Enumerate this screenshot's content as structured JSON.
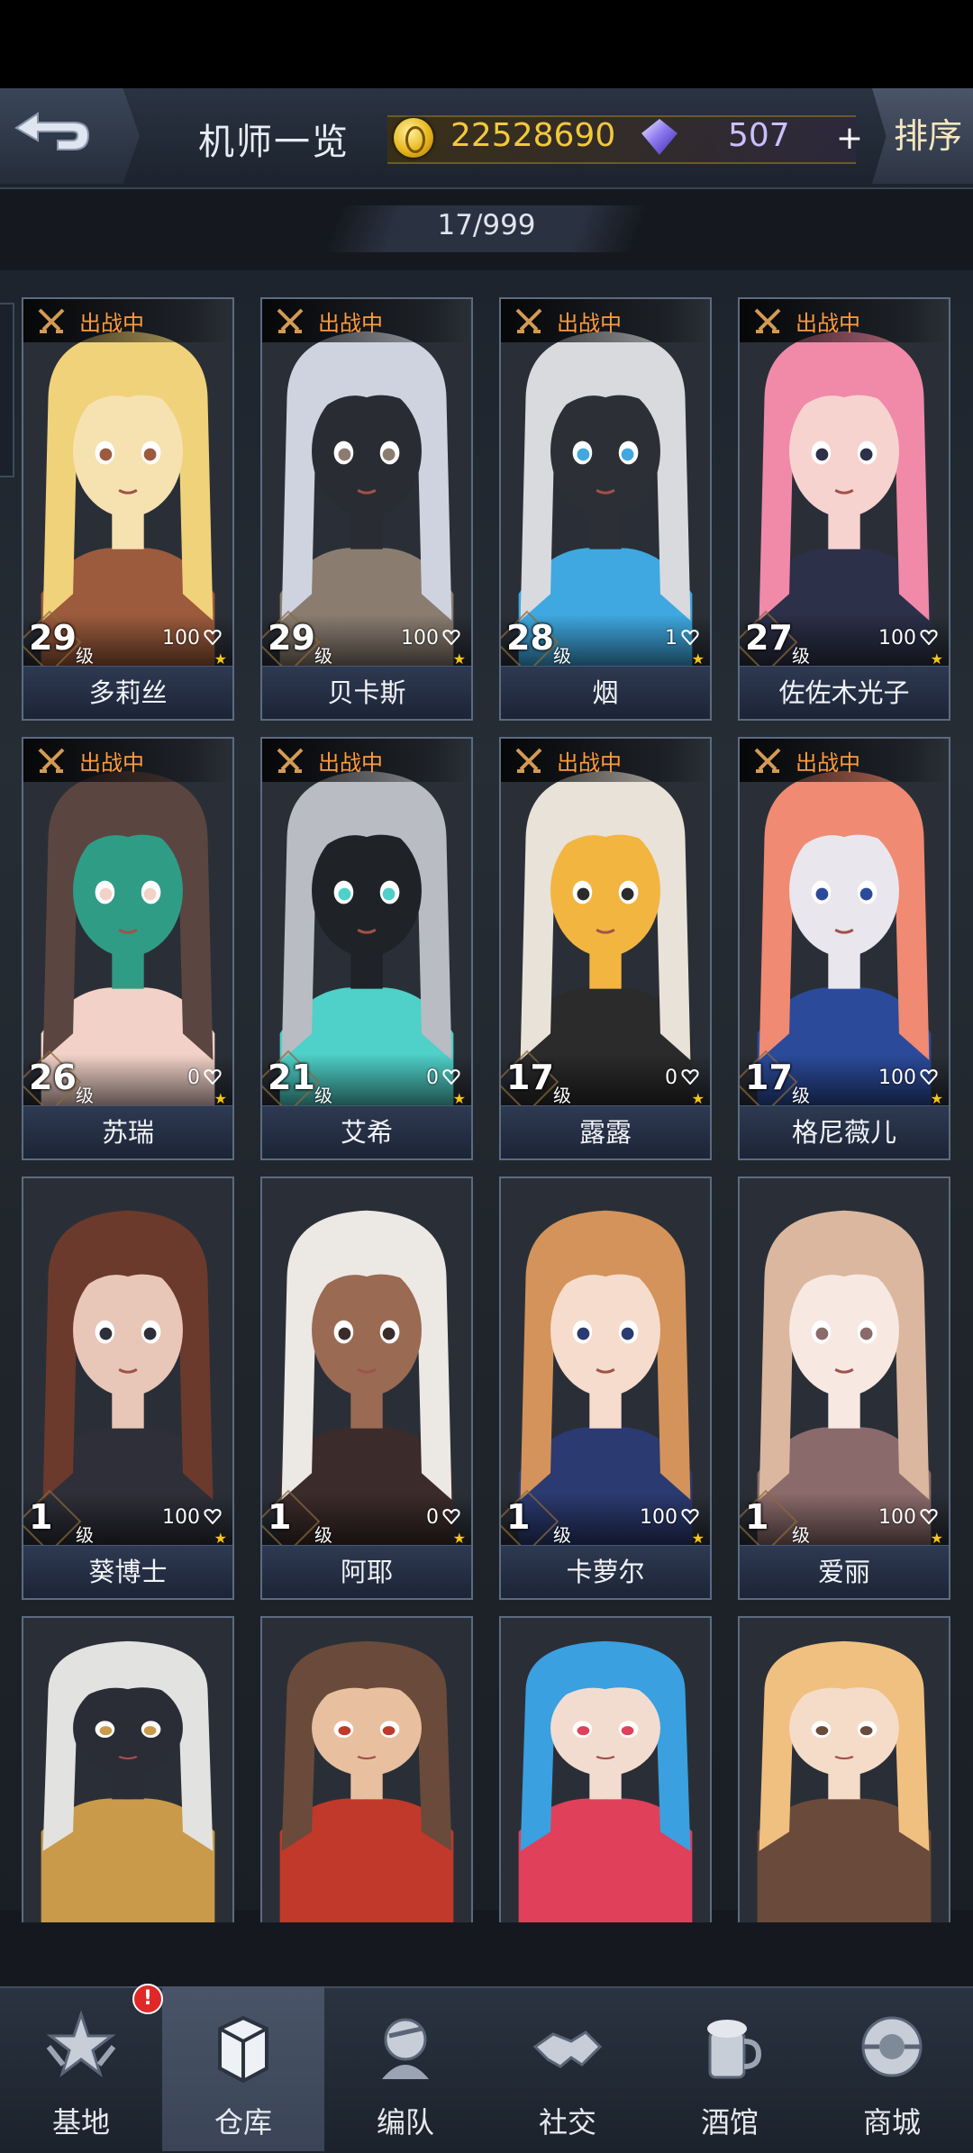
{
  "header": {
    "title": "机师一览",
    "gold": "22528690",
    "gems": "507",
    "plus": "+",
    "sort": "排序"
  },
  "counter": "17/999",
  "deploy_label": "出战中",
  "level_unit": "级",
  "pilots": [
    {
      "name": "多莉丝",
      "level": "29",
      "trust": "100",
      "deployed": true,
      "palette": [
        "#f0d27a",
        "#f6e2b0",
        "#9c5b3c"
      ]
    },
    {
      "name": "贝卡斯",
      "level": "29",
      "trust": "100",
      "deployed": true,
      "palette": [
        "#cfd3e0",
        "#2a2c33",
        "#8a7d70"
      ]
    },
    {
      "name": "烟",
      "level": "28",
      "trust": "1",
      "deployed": true,
      "palette": [
        "#d9dade",
        "#2c2f36",
        "#3fa8e0"
      ]
    },
    {
      "name": "佐佐木光子",
      "level": "27",
      "trust": "100",
      "deployed": true,
      "palette": [
        "#f08aa8",
        "#f7d3d0",
        "#2c3048"
      ]
    },
    {
      "name": "苏瑞",
      "level": "26",
      "trust": "0",
      "deployed": true,
      "palette": [
        "#5b4540",
        "#2f9c86",
        "#f2d2c8"
      ]
    },
    {
      "name": "艾希",
      "level": "21",
      "trust": "0",
      "deployed": true,
      "palette": [
        "#b9bcc2",
        "#1f2226",
        "#4fd0c8"
      ]
    },
    {
      "name": "露露",
      "level": "17",
      "trust": "0",
      "deployed": true,
      "palette": [
        "#e8e2d8",
        "#f2b540",
        "#2b2b2b"
      ]
    },
    {
      "name": "格尼薇儿",
      "level": "17",
      "trust": "100",
      "deployed": true,
      "palette": [
        "#f08a72",
        "#e9e6ee",
        "#2b4b9a"
      ]
    },
    {
      "name": "葵博士",
      "level": "1",
      "trust": "100",
      "deployed": false,
      "palette": [
        "#6b3a2c",
        "#e8c7b8",
        "#2e2f38"
      ]
    },
    {
      "name": "阿耶",
      "level": "1",
      "trust": "0",
      "deployed": false,
      "palette": [
        "#ece8e4",
        "#9a6a52",
        "#3b2b2a"
      ]
    },
    {
      "name": "卡萝尔",
      "level": "1",
      "trust": "100",
      "deployed": false,
      "palette": [
        "#d3935a",
        "#f5dccd",
        "#2b3a70"
      ]
    },
    {
      "name": "爱丽",
      "level": "1",
      "trust": "100",
      "deployed": false,
      "palette": [
        "#dab79e",
        "#f7e8e2",
        "#8a6a6a"
      ]
    },
    {
      "name": "",
      "level": "",
      "trust": "",
      "deployed": false,
      "palette": [
        "#e2e2e0",
        "#2a2c36",
        "#c89a4a"
      ]
    },
    {
      "name": "",
      "level": "",
      "trust": "",
      "deployed": false,
      "palette": [
        "#6a4a3a",
        "#e8c0a0",
        "#c0392b"
      ]
    },
    {
      "name": "",
      "level": "",
      "trust": "",
      "deployed": false,
      "palette": [
        "#3aa0e0",
        "#f2dcd0",
        "#e0405a"
      ]
    },
    {
      "name": "",
      "level": "",
      "trust": "",
      "deployed": false,
      "palette": [
        "#f0c080",
        "#f5dcc8",
        "#6a4a3a"
      ]
    }
  ],
  "nav": [
    {
      "label": "基地",
      "icon": "base-icon",
      "active": false
    },
    {
      "label": "仓库",
      "icon": "warehouse-icon",
      "active": true
    },
    {
      "label": "编队",
      "icon": "formation-icon",
      "active": false
    },
    {
      "label": "社交",
      "icon": "handshake-icon",
      "active": false
    },
    {
      "label": "酒馆",
      "icon": "tavern-icon",
      "active": false
    },
    {
      "label": "商城",
      "icon": "shop-icon",
      "active": false
    }
  ],
  "nav_badge": "!"
}
